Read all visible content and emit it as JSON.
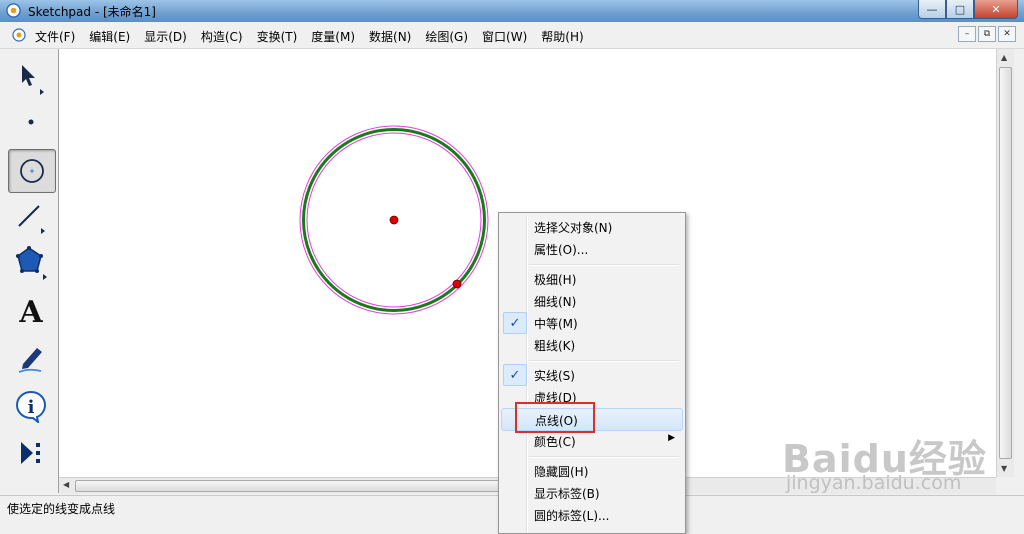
{
  "window": {
    "title": "Sketchpad  - [未命名1]",
    "controls": {
      "minimize": "—",
      "maximize": "□",
      "close": "✕"
    }
  },
  "menubar": {
    "items": [
      "文件(F)",
      "编辑(E)",
      "显示(D)",
      "构造(C)",
      "变换(T)",
      "度量(M)",
      "数据(N)",
      "绘图(G)",
      "窗口(W)",
      "帮助(H)"
    ],
    "doc_controls": {
      "minimize": "–",
      "restore": "⧉",
      "close": "✕"
    }
  },
  "toolbox": {
    "tools": [
      {
        "name": "selection-arrow",
        "selected": false
      },
      {
        "name": "point",
        "selected": false
      },
      {
        "name": "compass",
        "selected": true
      },
      {
        "name": "straightedge",
        "selected": false
      },
      {
        "name": "polygon",
        "selected": false
      },
      {
        "name": "text",
        "label": "A",
        "selected": false
      },
      {
        "name": "marker",
        "selected": false
      },
      {
        "name": "information",
        "label": "i",
        "selected": false
      },
      {
        "name": "custom-tools",
        "selected": false
      }
    ]
  },
  "canvas": {
    "circle": {
      "stroke_color": "#1a7a1a",
      "selection_color": "#e040e0"
    },
    "points": [
      {
        "name": "center",
        "color": "#e00000"
      },
      {
        "name": "radius-point",
        "color": "#e00000"
      }
    ]
  },
  "context_menu": {
    "items": [
      {
        "label": "选择父对象(N)",
        "checked": false
      },
      {
        "label": "属性(O)...",
        "checked": false
      },
      {
        "separator": true
      },
      {
        "label": "极细(H)",
        "checked": false
      },
      {
        "label": "细线(N)",
        "checked": false
      },
      {
        "label": "中等(M)",
        "checked": true
      },
      {
        "label": "粗线(K)",
        "checked": false
      },
      {
        "separator": true
      },
      {
        "label": "实线(S)",
        "checked": true
      },
      {
        "label": "虚线(D)",
        "checked": false
      },
      {
        "label": "点线(O)",
        "checked": false,
        "highlighted": true
      },
      {
        "label": "颜色(C)",
        "checked": false,
        "submenu": true
      },
      {
        "separator": true
      },
      {
        "label": "隐藏圆(H)",
        "checked": false
      },
      {
        "label": "显示标签(B)",
        "checked": false
      },
      {
        "label": "圆的标签(L)...",
        "checked": false
      }
    ],
    "check_mark": "✓",
    "submenu_arrow": "▶"
  },
  "annotation": {
    "highlight_color": "#d9312a"
  },
  "status": {
    "text": "使选定的线变成点线"
  },
  "watermark": {
    "logo": "Baidu经验",
    "url": "jingyan.baidu.com"
  }
}
